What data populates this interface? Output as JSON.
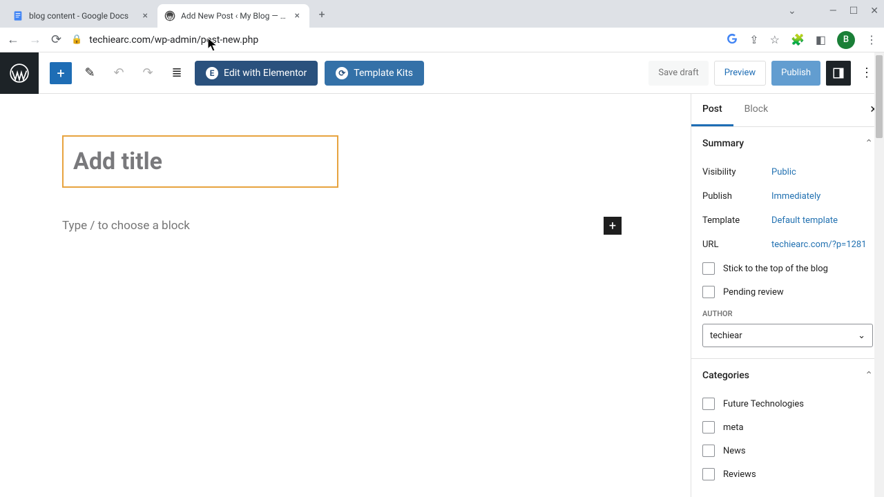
{
  "browser": {
    "tabs": [
      {
        "title": "blog content - Google Docs",
        "favicon": "gdocs"
      },
      {
        "title": "Add New Post ‹ My Blog — Wor",
        "favicon": "wp"
      }
    ],
    "url": "techiearc.com/wp-admin/post-new.php",
    "avatar_letter": "B"
  },
  "toolbar": {
    "elementor": "Edit with Elementor",
    "template_kits": "Template Kits",
    "save_draft": "Save draft",
    "preview": "Preview",
    "publish": "Publish"
  },
  "editor": {
    "title_placeholder": "Add title",
    "block_placeholder": "Type / to choose a block"
  },
  "sidebar": {
    "tabs": {
      "post": "Post",
      "block": "Block"
    },
    "summary": {
      "heading": "Summary",
      "visibility_label": "Visibility",
      "visibility_value": "Public",
      "publish_label": "Publish",
      "publish_value": "Immediately",
      "template_label": "Template",
      "template_value": "Default template",
      "url_label": "URL",
      "url_value": "techiearc.com/?p=1281",
      "stick": "Stick to the top of the blog",
      "pending": "Pending review",
      "author_label": "AUTHOR",
      "author_value": "techiear"
    },
    "categories": {
      "heading": "Categories",
      "items": [
        "Future Technologies",
        "meta",
        "News",
        "Reviews"
      ]
    }
  }
}
